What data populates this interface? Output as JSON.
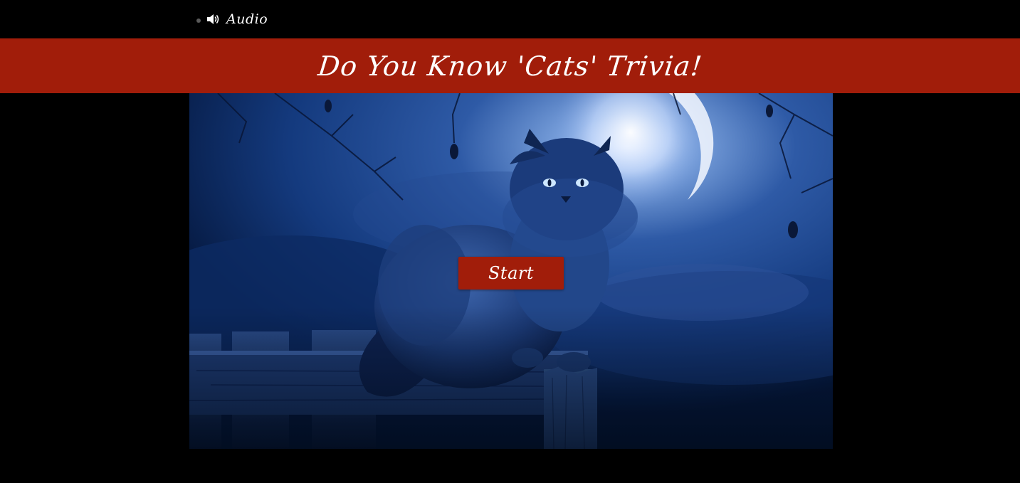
{
  "audio": {
    "label": "Audio",
    "icon": "speaker-icon"
  },
  "header": {
    "title": "Do You Know 'Cats' Trivia!"
  },
  "scene": {
    "image": "black-cat-on-fence-moonlight"
  },
  "controls": {
    "start_label": "Start"
  },
  "colors": {
    "banner": "#a11d0a",
    "button": "#a11d0a",
    "background": "#000000",
    "scene_tint": "#0c2a5c"
  }
}
